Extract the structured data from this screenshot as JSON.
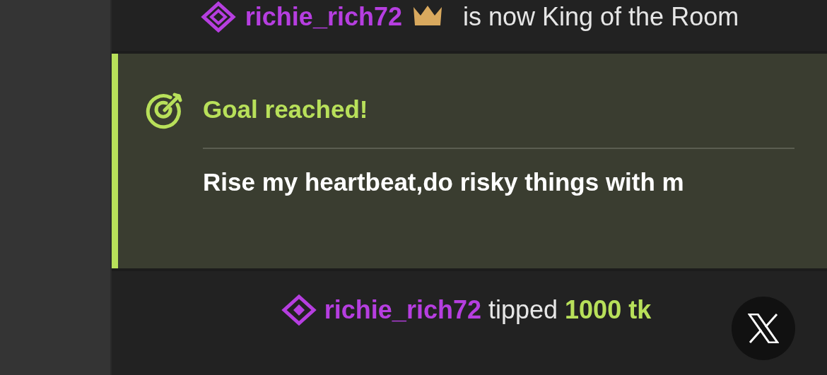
{
  "king_notice": {
    "username": "richie_rich72",
    "message": "is now King of the Room"
  },
  "goal": {
    "title": "Goal reached!",
    "description": "Rise my heartbeat,do risky things with m"
  },
  "tip_notice": {
    "username": "richie_rich72",
    "action": "tipped",
    "amount": "1000",
    "unit": "tk"
  }
}
